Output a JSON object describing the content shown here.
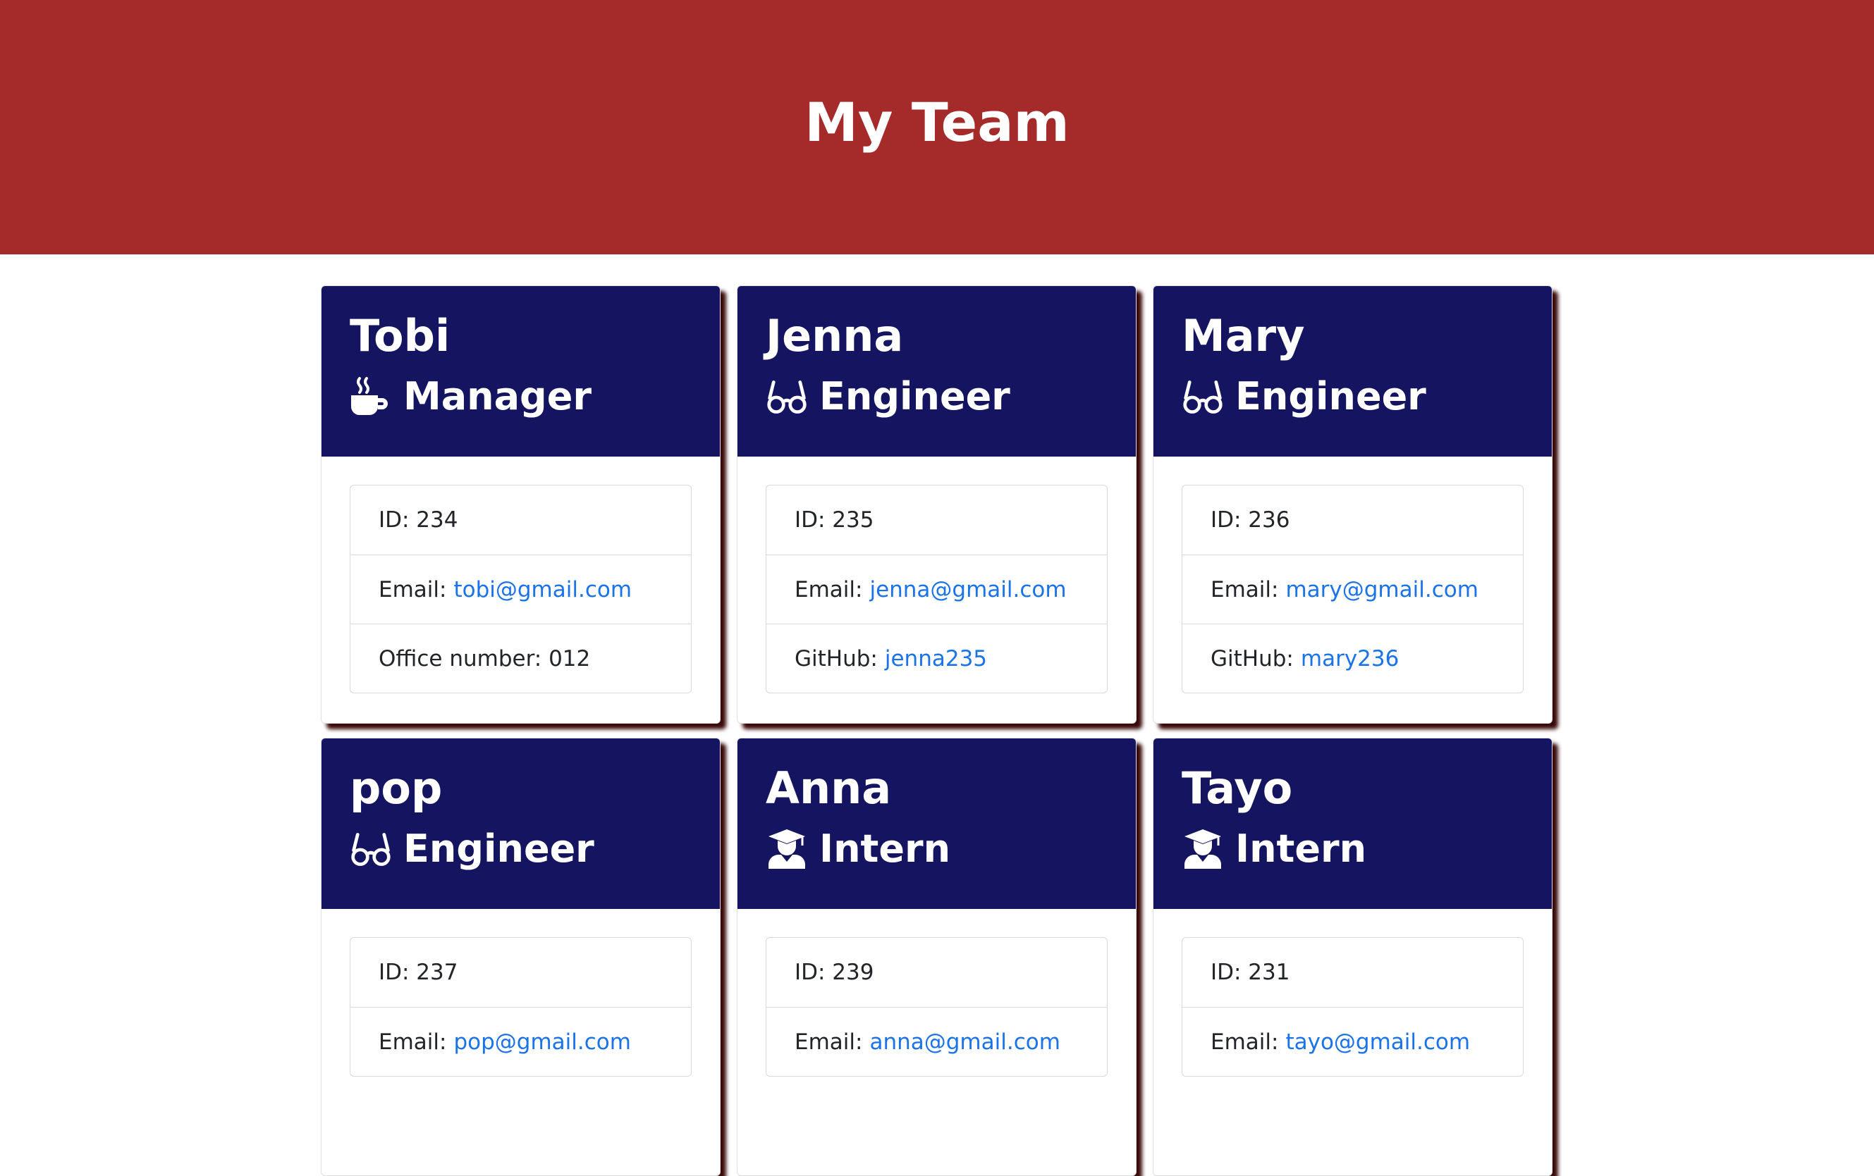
{
  "header": {
    "title": "My Team"
  },
  "team": [
    {
      "name": "Tobi",
      "role": "Manager",
      "icon": "coffee-icon",
      "id_text": "ID: 234",
      "email_label": "Email:",
      "email": "tobi@gmail.com",
      "extra_label": "Office number: 012",
      "extra_link": ""
    },
    {
      "name": "Jenna",
      "role": "Engineer",
      "icon": "glasses-icon",
      "id_text": "ID: 235",
      "email_label": "Email:",
      "email": "jenna@gmail.com",
      "extra_label": "GitHub:",
      "extra_link": "jenna235"
    },
    {
      "name": "Mary",
      "role": "Engineer",
      "icon": "glasses-icon",
      "id_text": "ID: 236",
      "email_label": "Email:",
      "email": "mary@gmail.com",
      "extra_label": "GitHub:",
      "extra_link": "mary236"
    },
    {
      "name": "pop",
      "role": "Engineer",
      "icon": "glasses-icon",
      "id_text": "ID: 237",
      "email_label": "Email:",
      "email": "pop@gmail.com",
      "extra_label": "",
      "extra_link": ""
    },
    {
      "name": "Anna",
      "role": "Intern",
      "icon": "graduate-icon",
      "id_text": "ID: 239",
      "email_label": "Email:",
      "email": "anna@gmail.com",
      "extra_label": "",
      "extra_link": ""
    },
    {
      "name": "Tayo",
      "role": "Intern",
      "icon": "graduate-icon",
      "id_text": "ID: 231",
      "email_label": "Email:",
      "email": "tayo@gmail.com",
      "extra_label": "",
      "extra_link": ""
    }
  ],
  "colors": {
    "banner": "#a52a2a",
    "card_header": "#141461",
    "link": "#1a73e8"
  }
}
